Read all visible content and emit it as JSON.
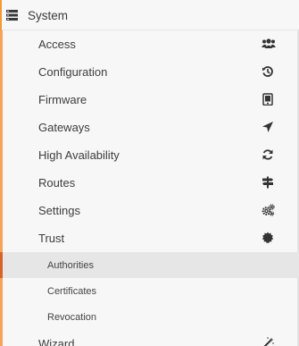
{
  "section": {
    "label": "System",
    "icon": "server-icon"
  },
  "items": [
    {
      "label": "Access",
      "icon": "users-icon"
    },
    {
      "label": "Configuration",
      "icon": "history-icon"
    },
    {
      "label": "Firmware",
      "icon": "tablet-icon"
    },
    {
      "label": "Gateways",
      "icon": "location-arrow-icon"
    },
    {
      "label": "High Availability",
      "icon": "refresh-icon"
    },
    {
      "label": "Routes",
      "icon": "signpost-icon"
    },
    {
      "label": "Settings",
      "icon": "cogs-icon"
    },
    {
      "label": "Trust",
      "icon": "certificate-icon"
    }
  ],
  "trust_subitems": [
    {
      "label": "Authorities",
      "active": true
    },
    {
      "label": "Certificates",
      "active": false
    },
    {
      "label": "Revocation",
      "active": false
    }
  ],
  "last_item": {
    "label": "Wizard",
    "icon": "magic-wand-icon"
  },
  "colors": {
    "accent_orange": "#f39a36",
    "active_accent": "#d9622b",
    "active_bg": "#e6e6e6"
  }
}
